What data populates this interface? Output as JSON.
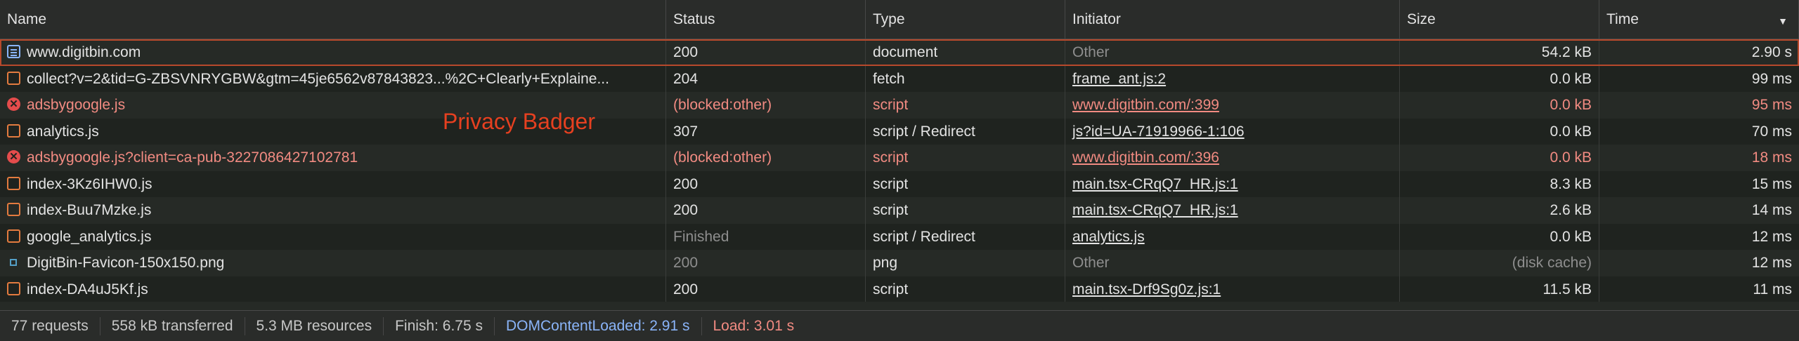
{
  "columns": {
    "name": "Name",
    "status": "Status",
    "type": "Type",
    "initiator": "Initiator",
    "size": "Size",
    "time": "Time",
    "sort_icon": "sort-desc-icon"
  },
  "annotation": "Privacy Badger",
  "rows": [
    {
      "icon": "document-icon",
      "name": "www.digitbin.com",
      "status": "200",
      "type": "document",
      "initiator": "Other",
      "size": "54.2 kB",
      "time": "2.90 s",
      "state": "selected"
    },
    {
      "icon": "script-icon",
      "name": "collect?v=2&tid=G-ZBSVNRYGBW&gtm=45je6562v87843823...%2C+Clearly+Explaine...",
      "status": "204",
      "type": "fetch",
      "initiator": "frame_ant.js:2",
      "size": "0.0 kB",
      "time": "99 ms",
      "state": "normal"
    },
    {
      "icon": "error-icon",
      "name": "adsbygoogle.js",
      "status": "(blocked:other)",
      "type": "script",
      "initiator": "www.digitbin.com/:399",
      "size": "0.0 kB",
      "time": "95 ms",
      "state": "blocked"
    },
    {
      "icon": "script-icon",
      "name": "analytics.js",
      "status": "307",
      "type": "script / Redirect",
      "initiator": "js?id=UA-71919966-1:106",
      "size": "0.0 kB",
      "time": "70 ms",
      "state": "normal"
    },
    {
      "icon": "error-icon",
      "name": "adsbygoogle.js?client=ca-pub-3227086427102781",
      "status": "(blocked:other)",
      "type": "script",
      "initiator": "www.digitbin.com/:396",
      "size": "0.0 kB",
      "time": "18 ms",
      "state": "blocked"
    },
    {
      "icon": "script-icon",
      "name": "index-3Kz6IHW0.js",
      "status": "200",
      "type": "script",
      "initiator": "main.tsx-CRqQ7_HR.js:1",
      "size": "8.3 kB",
      "time": "15 ms",
      "state": "normal"
    },
    {
      "icon": "script-icon",
      "name": "index-Buu7Mzke.js",
      "status": "200",
      "type": "script",
      "initiator": "main.tsx-CRqQ7_HR.js:1",
      "size": "2.6 kB",
      "time": "14 ms",
      "state": "normal"
    },
    {
      "icon": "script-icon",
      "name": "google_analytics.js",
      "status": "Finished",
      "type": "script / Redirect",
      "initiator": "analytics.js",
      "size": "0.0 kB",
      "time": "12 ms",
      "state": "finished"
    },
    {
      "icon": "image-icon",
      "name": "DigitBin-Favicon-150x150.png",
      "status": "200",
      "type": "png",
      "initiator": "Other",
      "size": "(disk cache)",
      "time": "12 ms",
      "state": "cached"
    },
    {
      "icon": "script-icon",
      "name": "index-DA4uJ5Kf.js",
      "status": "200",
      "type": "script",
      "initiator": "main.tsx-Drf9Sg0z.js:1",
      "size": "11.5 kB",
      "time": "11 ms",
      "state": "normal"
    }
  ],
  "footer": {
    "requests": "77 requests",
    "transferred": "558 kB transferred",
    "resources": "5.3 MB resources",
    "finish": "Finish: 6.75 s",
    "dcl": "DOMContentLoaded: 2.91 s",
    "load": "Load: 3.01 s"
  },
  "colors": {
    "background": "#1f231f",
    "selected_outline": "#b7492c",
    "blocked_text": "#f28b82",
    "annotation": "#e64020",
    "dcl": "#8ab4f8"
  }
}
